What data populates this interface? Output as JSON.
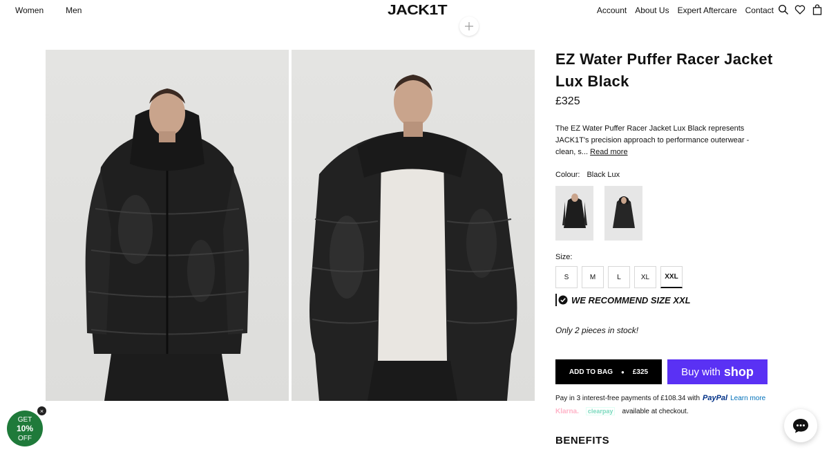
{
  "header": {
    "nav_left": [
      "Women",
      "Men"
    ],
    "logo": "JACK1T",
    "nav_right": [
      "Account",
      "About Us",
      "Expert Aftercare",
      "Contact"
    ],
    "icons": [
      "search-icon",
      "heart-icon",
      "bag-icon"
    ]
  },
  "gallery": {
    "images": [
      "jacket-front-model",
      "jacket-open-model"
    ],
    "zoom_icon": "plus-icon"
  },
  "product": {
    "title": "EZ Water Puffer Racer Jacket Lux Black",
    "price": "£325",
    "description": "The EZ Water Puffer Racer Jacket Lux Black represents JACK1T's precision approach to performance outerwear - clean, s...",
    "read_more": "Read more",
    "colour_label": "Colour:",
    "colour_value": "Black Lux",
    "size_label": "Size:",
    "sizes": [
      "S",
      "M",
      "L",
      "XL",
      "XXL"
    ],
    "selected_size": "XXL",
    "recommend": "WE RECOMMEND SIZE XXL",
    "stock": "Only 2 pieces in stock!",
    "add_to_bag": "ADD TO BAG",
    "bag_price": "£325",
    "buy_with": "Buy with",
    "shop_brand": "shop",
    "paypal_text": "Pay in 3 interest-free payments of £108.34 with",
    "paypal_brand": "PayPal",
    "learn_more": "Learn more",
    "klarna": "Klarna.",
    "clearpay": "clearpay",
    "available": "available at checkout.",
    "benefits": "BENEFITS"
  },
  "promo": {
    "line1": "GET",
    "line2": "10%",
    "line3": "OFF",
    "close": "×"
  },
  "colors": {
    "shop_pay": "#5a31f4",
    "add_bag": "#000000",
    "promo": "#1f7a3a"
  }
}
